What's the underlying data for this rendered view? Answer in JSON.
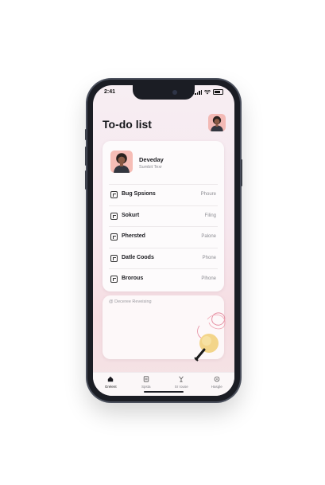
{
  "status_bar": {
    "time": "2:41"
  },
  "header": {
    "title": "To-do list"
  },
  "profile": {
    "name": "Deveday",
    "subtitle": "Sumbit Texr"
  },
  "tasks": [
    {
      "label": "Bug Spsions",
      "value": "Phoure",
      "icon": "clipboard-icon"
    },
    {
      "label": "Sokurt",
      "value": "Filing",
      "icon": "export-icon"
    },
    {
      "label": "Phersted",
      "value": "Palone",
      "icon": "document-icon"
    },
    {
      "label": "Datle Coods",
      "value": "Phone",
      "icon": "calendar-icon"
    },
    {
      "label": "Brorous",
      "value": "Plhone",
      "icon": "image-icon"
    }
  ],
  "note": {
    "placeholder": "@ Deceree Reveising"
  },
  "tabbar": {
    "items": [
      {
        "label": "Grelent",
        "icon": "home-icon",
        "active": true
      },
      {
        "label": "Spsta",
        "icon": "task-icon",
        "active": false
      },
      {
        "label": "Sr rouse",
        "icon": "trophy-icon",
        "active": false
      },
      {
        "label": "Hasgle",
        "icon": "settings-icon",
        "active": false
      }
    ]
  },
  "colors": {
    "screen_bg_top": "#f7eef3",
    "screen_bg_bottom": "#f6dde2",
    "card_bg": "#fdfbfc",
    "avatar_bg": "#f6bdb6",
    "phone_frame": "#1b1d24",
    "text_primary": "#1a1a1f",
    "text_secondary": "#8c8c92"
  }
}
